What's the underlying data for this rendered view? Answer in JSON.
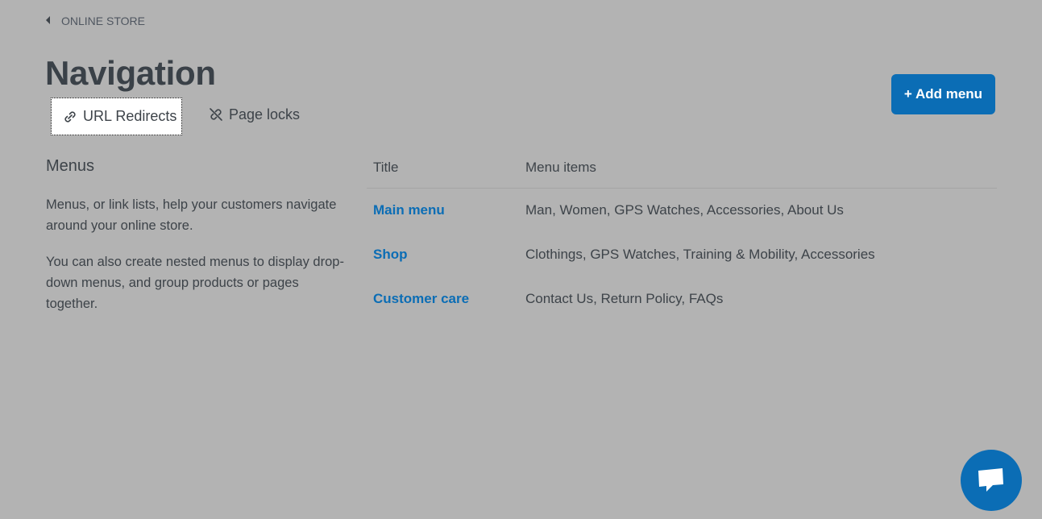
{
  "breadcrumb": {
    "label": "ONLINE STORE"
  },
  "page": {
    "title": "Navigation"
  },
  "tabs": {
    "redirects_label": "URL Redirects",
    "locks_label": "Page locks"
  },
  "toolbar": {
    "add_menu_label": "+ Add menu"
  },
  "sidebar": {
    "heading": "Menus",
    "paragraph1": "Menus, or link lists, help your customers navigate around your online store.",
    "paragraph2": "You can also create nested menus to display drop-down menus, and group products or pages together."
  },
  "table": {
    "headers": {
      "title": "Title",
      "items": "Menu items"
    },
    "rows": [
      {
        "title": "Main menu",
        "items": "Man, Women, GPS Watches, Accessories, About Us"
      },
      {
        "title": "Shop",
        "items": "Clothings, GPS Watches, Training & Mobility, Accessories"
      },
      {
        "title": "Customer care",
        "items": "Contact Us, Return Policy, FAQs"
      }
    ]
  },
  "icons": {
    "back": "caret-left-icon",
    "redirect": "link-icon",
    "lock": "unlink-icon",
    "chat": "chat-bubble-icon"
  },
  "colors": {
    "background": "#b3b3b3",
    "accent": "#0b6db5",
    "text": "#3d4349"
  }
}
